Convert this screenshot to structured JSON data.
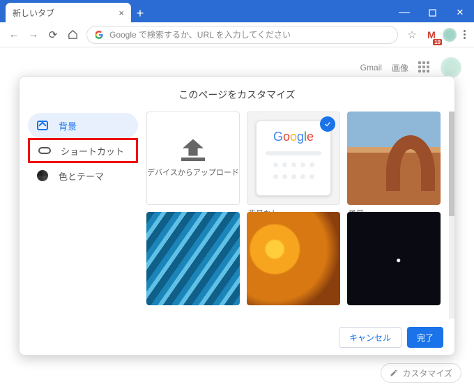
{
  "window": {
    "min": "—",
    "max": "▢",
    "close": "✕"
  },
  "tab": {
    "title": "新しいタブ"
  },
  "toolbar": {
    "search_placeholder": "Google で検索するか、URL を入力してください",
    "gmail_badge": "10",
    "star": "☆"
  },
  "ntp": {
    "links": {
      "gmail": "Gmail",
      "images": "画像"
    },
    "customize_label": "カスタマイズ"
  },
  "dialog": {
    "title": "このページをカスタマイズ",
    "sidebar": {
      "background": "背景",
      "shortcuts": "ショートカット",
      "color": "色とテーマ"
    },
    "tiles": {
      "upload": "デバイスからアップロード",
      "nobg": "背景なし",
      "landscape": "風景"
    },
    "footer": {
      "cancel": "キャンセル",
      "ok": "完了"
    }
  }
}
